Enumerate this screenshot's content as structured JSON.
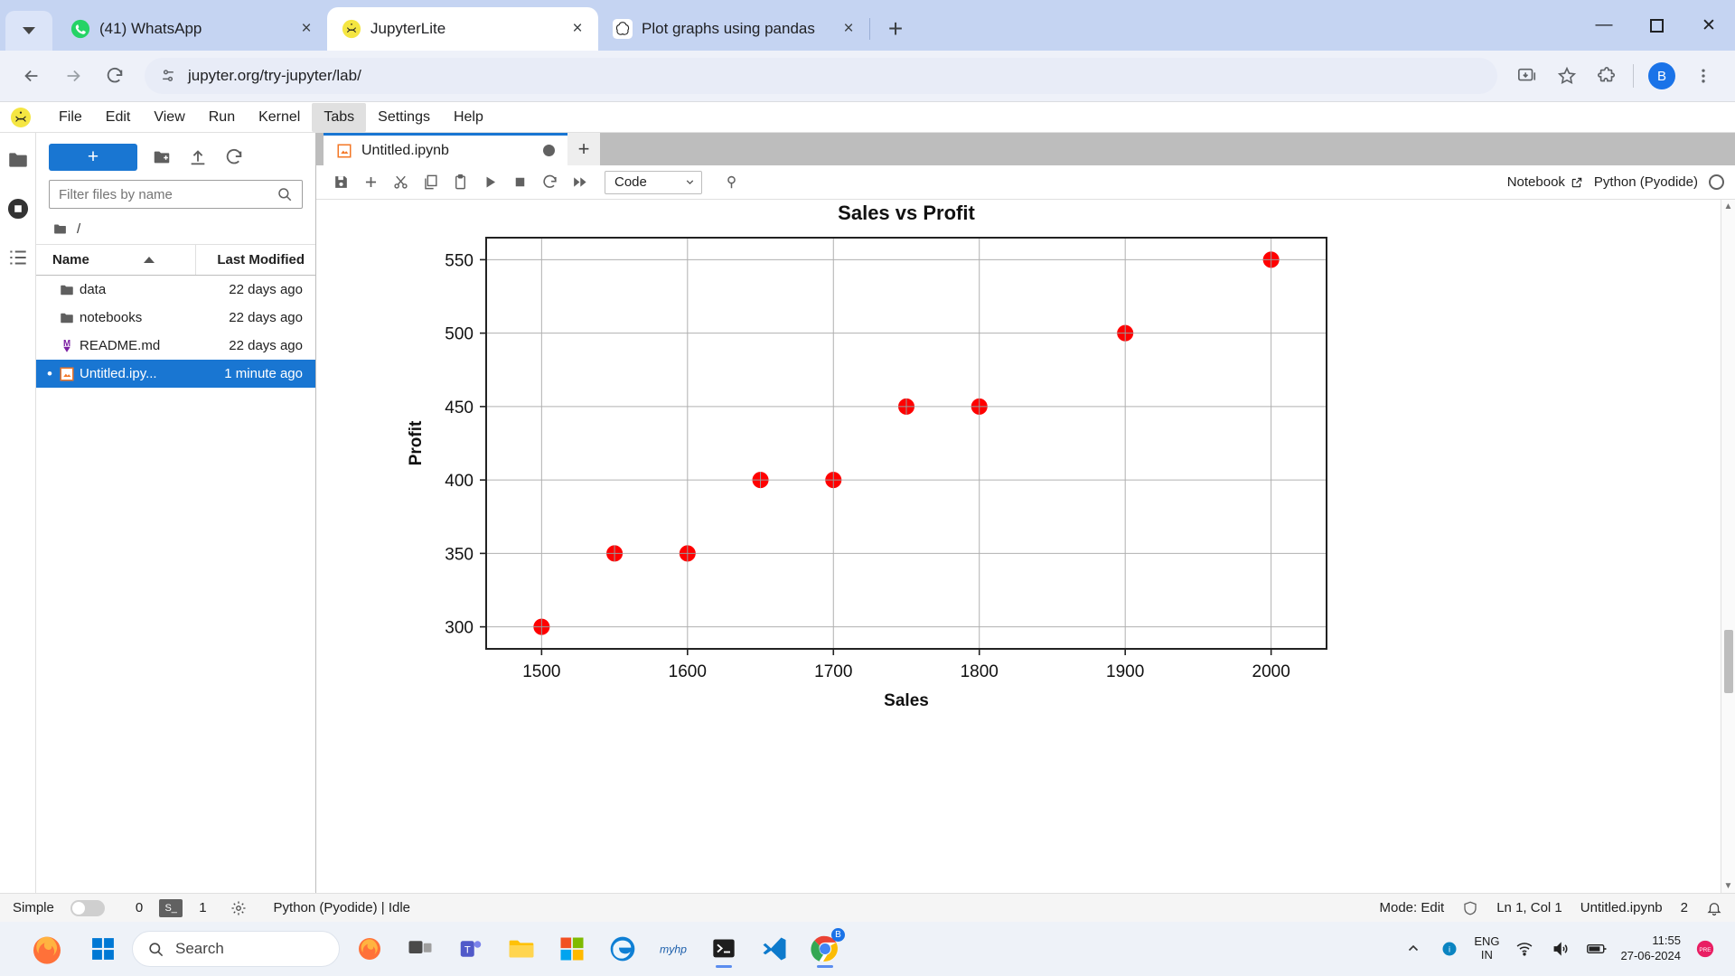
{
  "browser": {
    "tabs": [
      {
        "title": "(41) WhatsApp",
        "icon": "whatsapp-icon",
        "active": false
      },
      {
        "title": "JupyterLite",
        "icon": "jupyter-icon",
        "active": true
      },
      {
        "title": "Plot graphs using pandas",
        "icon": "chatgpt-icon",
        "active": false
      }
    ],
    "new_tab_label": "+",
    "close_label": "×",
    "window": {
      "minimize": "—",
      "maximize": "☐",
      "close": "✕"
    },
    "url": "jupyter.org/try-jupyter/lab/",
    "profile_initial": "B"
  },
  "jupyter": {
    "menus": [
      {
        "label": "File",
        "active": false
      },
      {
        "label": "Edit",
        "active": false
      },
      {
        "label": "View",
        "active": false
      },
      {
        "label": "Run",
        "active": false
      },
      {
        "label": "Kernel",
        "active": false
      },
      {
        "label": "Tabs",
        "active": true
      },
      {
        "label": "Settings",
        "active": false
      },
      {
        "label": "Help",
        "active": false
      }
    ],
    "filebrowser": {
      "new_launcher_label": "+",
      "new_folder_icon": "new-folder-icon",
      "upload_icon": "upload-icon",
      "refresh_icon": "refresh-icon",
      "filter_placeholder": "Filter files by name",
      "filter_value": "",
      "breadcrumb_root": "/",
      "col_name": "Name",
      "col_modified": "Last Modified",
      "rows": [
        {
          "name": "data",
          "modified": "22 days ago",
          "type": "folder",
          "selected": false,
          "dirty": false
        },
        {
          "name": "notebooks",
          "modified": "22 days ago",
          "type": "folder",
          "selected": false,
          "dirty": false
        },
        {
          "name": "README.md",
          "modified": "22 days ago",
          "type": "markdown",
          "selected": false,
          "dirty": false
        },
        {
          "name": "Untitled.ipy...",
          "modified": "1 minute ago",
          "type": "notebook",
          "selected": true,
          "dirty": true
        }
      ]
    },
    "notebook": {
      "tab_title": "Untitled.ipynb",
      "add_tab_label": "+",
      "cell_type": "Code",
      "kernel_mode": "Notebook",
      "kernel_name": "Python (Pyodide)",
      "toolbar_icons": [
        "save-icon",
        "insert-cell-icon",
        "cut-icon",
        "copy-icon",
        "paste-icon",
        "run-icon",
        "stop-icon",
        "restart-icon",
        "restart-run-all-icon",
        "debug-icon"
      ]
    },
    "statusbar": {
      "simple_label": "Simple",
      "terminals_count": "0",
      "kernels_count": "1",
      "kernel_status": "Python (Pyodide) | Idle",
      "mode": "Mode: Edit",
      "cursor": "Ln 1, Col 1",
      "filename": "Untitled.ipynb",
      "cell_count": "2"
    }
  },
  "chart_data": {
    "type": "scatter",
    "title": "Sales vs Profit",
    "xlabel": "Sales",
    "ylabel": "Profit",
    "x": [
      1500,
      1550,
      1600,
      1650,
      1700,
      1750,
      1800,
      1900,
      2000
    ],
    "y": [
      300,
      350,
      350,
      400,
      400,
      450,
      450,
      500,
      550
    ],
    "xticks": [
      1500,
      1600,
      1700,
      1800,
      1900,
      2000
    ],
    "yticks": [
      300,
      350,
      400,
      450,
      500,
      550
    ],
    "xlim": [
      1462,
      2038
    ],
    "ylim": [
      285,
      565
    ],
    "grid": true,
    "marker_color": "#ff0000",
    "marker_size": 9,
    "legend": null
  },
  "taskbar": {
    "start_icon": "windows-start-icon",
    "search_placeholder": "Search",
    "apps": [
      {
        "name": "task-view-icon",
        "running": false
      },
      {
        "name": "teams-icon",
        "running": false
      },
      {
        "name": "file-explorer-icon",
        "running": false
      },
      {
        "name": "microsoft-store-icon",
        "running": false
      },
      {
        "name": "edge-icon",
        "running": false
      },
      {
        "name": "myhp-icon",
        "running": false
      },
      {
        "name": "terminal-icon",
        "running": true
      },
      {
        "name": "vscode-icon",
        "running": false
      },
      {
        "name": "chrome-icon",
        "running": true
      }
    ],
    "language": "ENG",
    "region": "IN",
    "time": "11:55",
    "date": "27-06-2024",
    "notification_label": "PRE"
  }
}
